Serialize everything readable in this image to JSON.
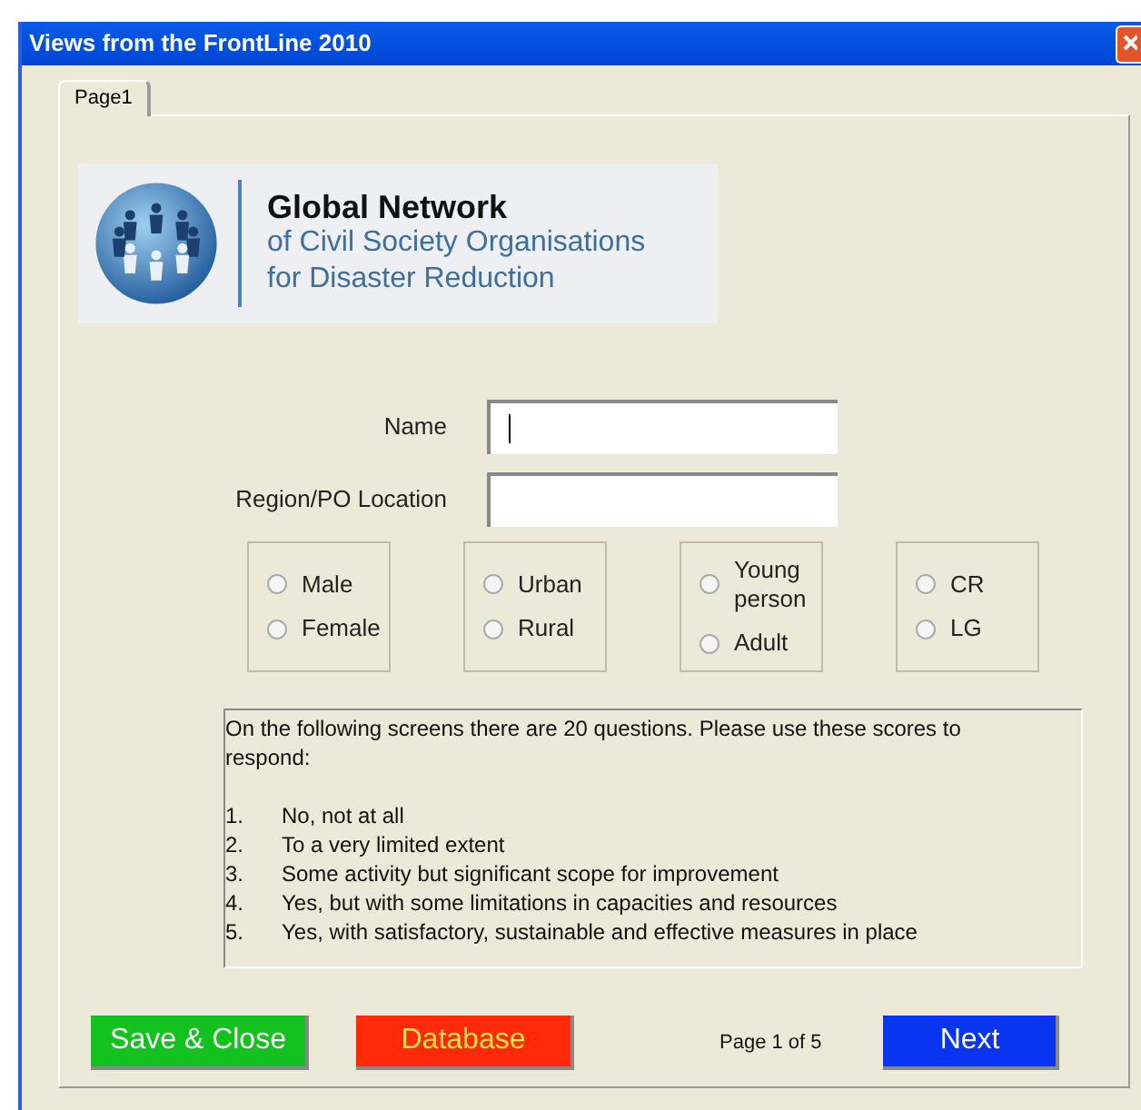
{
  "window": {
    "title": "Views from the FrontLine 2010"
  },
  "tabs": [
    {
      "label": "Page1",
      "selected": true
    }
  ],
  "logo": {
    "title": "Global Network",
    "subtitle_lines": [
      "of Civil Society Organisations",
      "for Disaster Reduction"
    ]
  },
  "fields": [
    {
      "label": "Name",
      "focused": true
    },
    {
      "label": "Region/PO Location",
      "focused": false
    }
  ],
  "radio_groups": [
    {
      "options": [
        {
          "label": "Male",
          "selected": false
        },
        {
          "label": "Female",
          "selected": false
        }
      ]
    },
    {
      "options": [
        {
          "label": "Urban",
          "selected": false
        },
        {
          "label": "Rural",
          "selected": false
        }
      ]
    },
    {
      "options": [
        {
          "label": "Young person",
          "selected": false
        },
        {
          "label": "Adult",
          "selected": false
        }
      ]
    },
    {
      "options": [
        {
          "label": "CR",
          "selected": false
        },
        {
          "label": "LG",
          "selected": false
        }
      ]
    }
  ],
  "instructions": {
    "intro": "On the following screens there are 20 questions. Please use these scores to respond:",
    "scores": [
      {
        "number": "1.",
        "text": "No, not at all"
      },
      {
        "number": "2.",
        "text": "To a very limited extent"
      },
      {
        "number": "3.",
        "text": "Some activity but significant scope for improvement"
      },
      {
        "number": "4.",
        "text": "Yes, but with some limitations in capacities and resources"
      },
      {
        "number": "5.",
        "text": "Yes, with satisfactory, sustainable and effective measures in place"
      }
    ]
  },
  "buttons": [
    {
      "label": "Save & Close",
      "color": "#13c21f"
    },
    {
      "label": "Database",
      "color": "#ff2a0a"
    }
  ],
  "page_indicator": "Page 1 of 5",
  "next_button": {
    "label": "Next",
    "color": "#0a35f0"
  }
}
